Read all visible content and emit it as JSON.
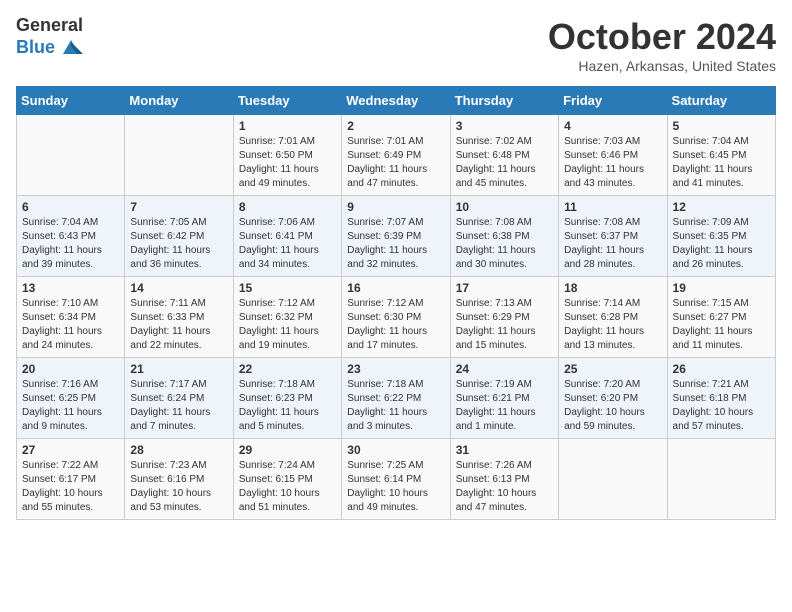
{
  "header": {
    "logo_general": "General",
    "logo_blue": "Blue",
    "month_title": "October 2024",
    "location": "Hazen, Arkansas, United States"
  },
  "calendar": {
    "days_of_week": [
      "Sunday",
      "Monday",
      "Tuesday",
      "Wednesday",
      "Thursday",
      "Friday",
      "Saturday"
    ],
    "weeks": [
      [
        {
          "day": "",
          "info": ""
        },
        {
          "day": "",
          "info": ""
        },
        {
          "day": "1",
          "info": "Sunrise: 7:01 AM\nSunset: 6:50 PM\nDaylight: 11 hours and 49 minutes."
        },
        {
          "day": "2",
          "info": "Sunrise: 7:01 AM\nSunset: 6:49 PM\nDaylight: 11 hours and 47 minutes."
        },
        {
          "day": "3",
          "info": "Sunrise: 7:02 AM\nSunset: 6:48 PM\nDaylight: 11 hours and 45 minutes."
        },
        {
          "day": "4",
          "info": "Sunrise: 7:03 AM\nSunset: 6:46 PM\nDaylight: 11 hours and 43 minutes."
        },
        {
          "day": "5",
          "info": "Sunrise: 7:04 AM\nSunset: 6:45 PM\nDaylight: 11 hours and 41 minutes."
        }
      ],
      [
        {
          "day": "6",
          "info": "Sunrise: 7:04 AM\nSunset: 6:43 PM\nDaylight: 11 hours and 39 minutes."
        },
        {
          "day": "7",
          "info": "Sunrise: 7:05 AM\nSunset: 6:42 PM\nDaylight: 11 hours and 36 minutes."
        },
        {
          "day": "8",
          "info": "Sunrise: 7:06 AM\nSunset: 6:41 PM\nDaylight: 11 hours and 34 minutes."
        },
        {
          "day": "9",
          "info": "Sunrise: 7:07 AM\nSunset: 6:39 PM\nDaylight: 11 hours and 32 minutes."
        },
        {
          "day": "10",
          "info": "Sunrise: 7:08 AM\nSunset: 6:38 PM\nDaylight: 11 hours and 30 minutes."
        },
        {
          "day": "11",
          "info": "Sunrise: 7:08 AM\nSunset: 6:37 PM\nDaylight: 11 hours and 28 minutes."
        },
        {
          "day": "12",
          "info": "Sunrise: 7:09 AM\nSunset: 6:35 PM\nDaylight: 11 hours and 26 minutes."
        }
      ],
      [
        {
          "day": "13",
          "info": "Sunrise: 7:10 AM\nSunset: 6:34 PM\nDaylight: 11 hours and 24 minutes."
        },
        {
          "day": "14",
          "info": "Sunrise: 7:11 AM\nSunset: 6:33 PM\nDaylight: 11 hours and 22 minutes."
        },
        {
          "day": "15",
          "info": "Sunrise: 7:12 AM\nSunset: 6:32 PM\nDaylight: 11 hours and 19 minutes."
        },
        {
          "day": "16",
          "info": "Sunrise: 7:12 AM\nSunset: 6:30 PM\nDaylight: 11 hours and 17 minutes."
        },
        {
          "day": "17",
          "info": "Sunrise: 7:13 AM\nSunset: 6:29 PM\nDaylight: 11 hours and 15 minutes."
        },
        {
          "day": "18",
          "info": "Sunrise: 7:14 AM\nSunset: 6:28 PM\nDaylight: 11 hours and 13 minutes."
        },
        {
          "day": "19",
          "info": "Sunrise: 7:15 AM\nSunset: 6:27 PM\nDaylight: 11 hours and 11 minutes."
        }
      ],
      [
        {
          "day": "20",
          "info": "Sunrise: 7:16 AM\nSunset: 6:25 PM\nDaylight: 11 hours and 9 minutes."
        },
        {
          "day": "21",
          "info": "Sunrise: 7:17 AM\nSunset: 6:24 PM\nDaylight: 11 hours and 7 minutes."
        },
        {
          "day": "22",
          "info": "Sunrise: 7:18 AM\nSunset: 6:23 PM\nDaylight: 11 hours and 5 minutes."
        },
        {
          "day": "23",
          "info": "Sunrise: 7:18 AM\nSunset: 6:22 PM\nDaylight: 11 hours and 3 minutes."
        },
        {
          "day": "24",
          "info": "Sunrise: 7:19 AM\nSunset: 6:21 PM\nDaylight: 11 hours and 1 minute."
        },
        {
          "day": "25",
          "info": "Sunrise: 7:20 AM\nSunset: 6:20 PM\nDaylight: 10 hours and 59 minutes."
        },
        {
          "day": "26",
          "info": "Sunrise: 7:21 AM\nSunset: 6:18 PM\nDaylight: 10 hours and 57 minutes."
        }
      ],
      [
        {
          "day": "27",
          "info": "Sunrise: 7:22 AM\nSunset: 6:17 PM\nDaylight: 10 hours and 55 minutes."
        },
        {
          "day": "28",
          "info": "Sunrise: 7:23 AM\nSunset: 6:16 PM\nDaylight: 10 hours and 53 minutes."
        },
        {
          "day": "29",
          "info": "Sunrise: 7:24 AM\nSunset: 6:15 PM\nDaylight: 10 hours and 51 minutes."
        },
        {
          "day": "30",
          "info": "Sunrise: 7:25 AM\nSunset: 6:14 PM\nDaylight: 10 hours and 49 minutes."
        },
        {
          "day": "31",
          "info": "Sunrise: 7:26 AM\nSunset: 6:13 PM\nDaylight: 10 hours and 47 minutes."
        },
        {
          "day": "",
          "info": ""
        },
        {
          "day": "",
          "info": ""
        }
      ]
    ]
  }
}
